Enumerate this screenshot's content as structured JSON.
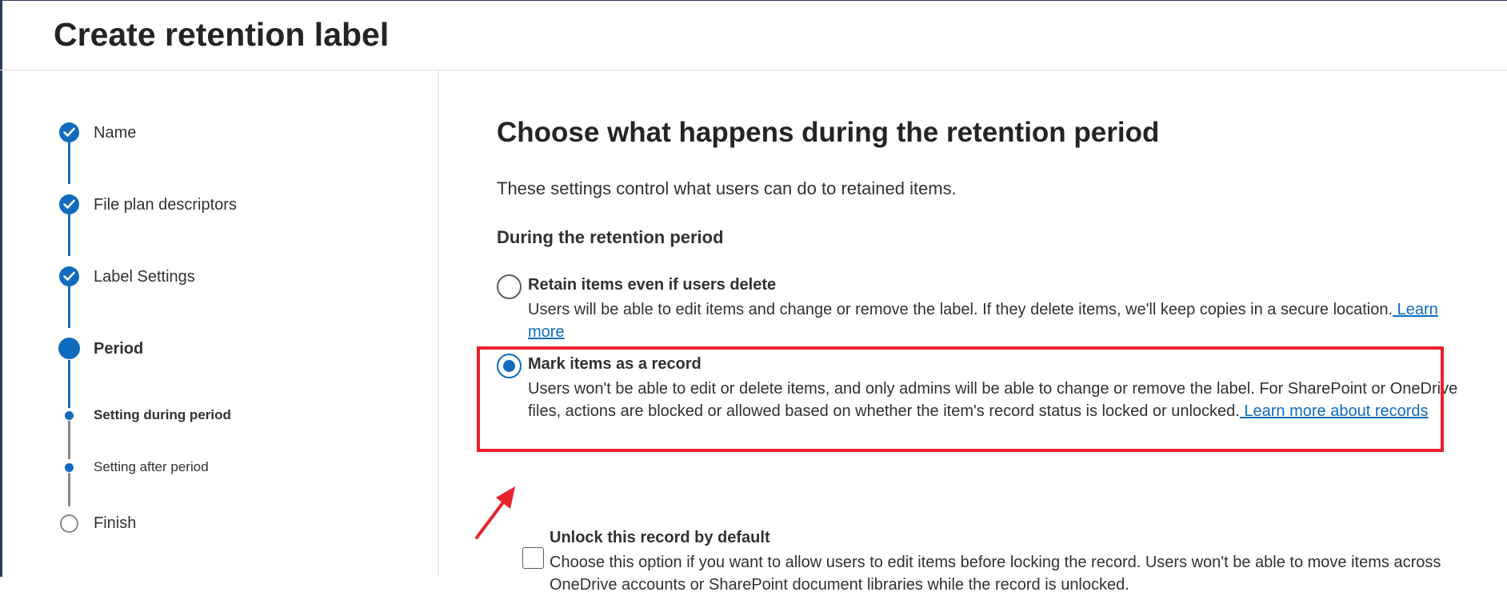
{
  "header": {
    "title": "Create retention label"
  },
  "steps": [
    {
      "label": "Name",
      "state": "completed"
    },
    {
      "label": "File plan descriptors",
      "state": "completed"
    },
    {
      "label": "Label Settings",
      "state": "completed"
    },
    {
      "label": "Period",
      "state": "current"
    },
    {
      "label": "Setting during period",
      "state": "current-substep"
    },
    {
      "label": "Setting after period",
      "state": "substep"
    },
    {
      "label": "Finish",
      "state": "not-started"
    }
  ],
  "main": {
    "title": "Choose what happens during the retention period",
    "description": "These settings control what users can do to retained items.",
    "section_heading": "During the retention period",
    "options": [
      {
        "title": "Retain items even if users delete",
        "description": "Users will be able to edit items and change or remove the label. If they delete items, we'll keep copies in a secure location.",
        "link": " Learn more",
        "selected": false
      },
      {
        "title": "Mark items as a record",
        "description": "Users won't be able to edit or delete items, and only admins will be able to change or remove the label. For SharePoint or OneDrive files, actions are blocked or allowed based on whether the item's record status is locked or unlocked.",
        "link": " Learn more about records",
        "selected": true
      }
    ],
    "checkbox": {
      "title": "Unlock this record by default",
      "description": "Choose this option if you want to allow users to edit items before locking the record. Users won't be able to move items across OneDrive accounts or SharePoint document libraries while the record is unlocked.",
      "checked": false
    }
  },
  "colors": {
    "accent": "#0f6cbd",
    "highlight": "#e8222d",
    "text": "#323130"
  }
}
